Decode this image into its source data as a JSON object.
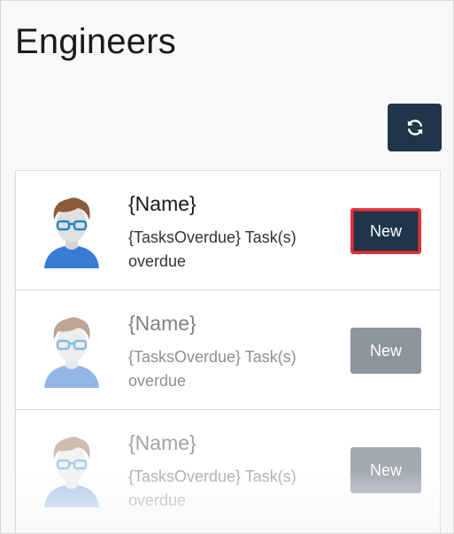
{
  "header": {
    "title": "Engineers"
  },
  "toolbar": {
    "refresh_icon": "refresh-icon"
  },
  "engineers": [
    {
      "name": "{Name}",
      "tasks": "{TasksOverdue} Task(s) overdue",
      "button_label": "New",
      "state": "selected"
    },
    {
      "name": "{Name}",
      "tasks": "{TasksOverdue} Task(s) overdue",
      "button_label": "New",
      "state": "dimmed"
    },
    {
      "name": "{Name}",
      "tasks": "{TasksOverdue} Task(s) overdue",
      "button_label": "New",
      "state": "faded"
    }
  ],
  "colors": {
    "primary": "#1f3549",
    "selected_outline": "#e0333f",
    "disabled_button": "#8c959e",
    "avatar_shirt": "#3a7bd5",
    "avatar_hair": "#8a5a3b"
  }
}
